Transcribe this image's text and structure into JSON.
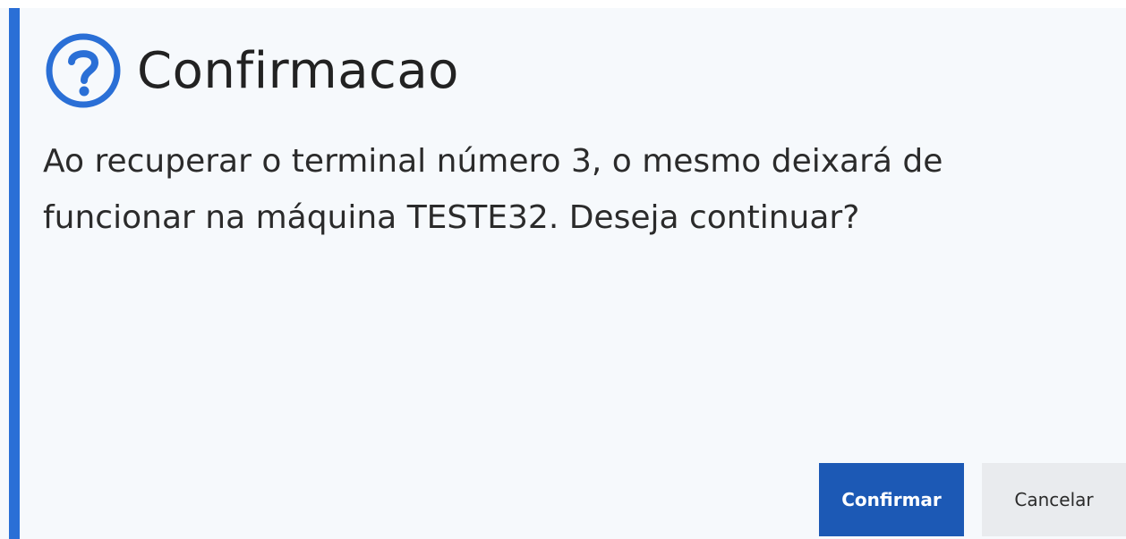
{
  "dialog": {
    "icon": "question-circle-icon",
    "title": "Confirmacao",
    "message": "Ao recuperar o terminal número 3, o mesmo deixará de funcionar na máquina TESTE32. Deseja continuar?",
    "buttons": {
      "confirm_label": "Confirmar",
      "cancel_label": "Cancelar"
    }
  },
  "colors": {
    "accent": "#2a6fd6",
    "primary_button": "#1c59b5",
    "secondary_button": "#e9ebee",
    "background": "#f6f9fc"
  }
}
